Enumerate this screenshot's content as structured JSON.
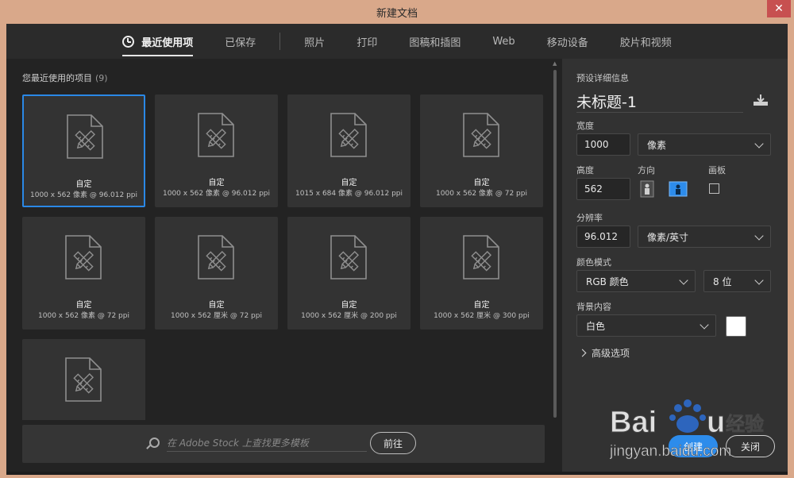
{
  "window": {
    "title": "新建文档",
    "close_glyph": "✕"
  },
  "tabs": [
    {
      "label": "最近使用项",
      "active": true,
      "icon": "clock-icon"
    },
    {
      "label": "已保存"
    },
    {
      "label": "照片"
    },
    {
      "label": "打印"
    },
    {
      "label": "图稿和插图"
    },
    {
      "label": "Web"
    },
    {
      "label": "移动设备"
    },
    {
      "label": "胶片和视频"
    }
  ],
  "recent": {
    "title": "您最近使用的项目",
    "count": "(9)",
    "items": [
      {
        "name": "自定",
        "desc": "1000 x 562 像素 @ 96.012 ppi",
        "selected": true
      },
      {
        "name": "自定",
        "desc": "1000 x 562 像素 @ 96.012 ppi"
      },
      {
        "name": "自定",
        "desc": "1015 x 684 像素 @ 96.012 ppi"
      },
      {
        "name": "自定",
        "desc": "1000 x 562 像素 @ 72 ppi"
      },
      {
        "name": "自定",
        "desc": "1000 x 562 像素 @ 72 ppi"
      },
      {
        "name": "自定",
        "desc": "1000 x 562 厘米 @ 72 ppi"
      },
      {
        "name": "自定",
        "desc": "1000 x 562 厘米 @ 200 ppi"
      },
      {
        "name": "自定",
        "desc": "1000 x 562 厘米 @ 300 ppi"
      },
      {
        "name": "",
        "desc": ""
      }
    ]
  },
  "stock_search": {
    "placeholder": "在 Adobe Stock 上查找更多模板",
    "go_label": "前往"
  },
  "preset": {
    "section_label": "预设详细信息",
    "doc_name": "未标题-1",
    "width_label": "宽度",
    "width_value": "1000",
    "width_unit": "像素",
    "height_label": "高度",
    "height_value": "562",
    "orientation_label": "方向",
    "artboard_label": "画板",
    "resolution_label": "分辨率",
    "resolution_value": "96.012",
    "resolution_unit": "像素/英寸",
    "color_mode_label": "颜色模式",
    "color_mode": "RGB 颜色",
    "bit_depth": "8 位",
    "background_label": "背景内容",
    "background": "白色",
    "background_color": "#ffffff",
    "advanced_label": "高级选项",
    "create_label": "创建",
    "close_label": "关闭"
  },
  "colors": {
    "accent": "#2d8ceb",
    "titlebar": "#d9a88a",
    "panel": "#323232"
  }
}
